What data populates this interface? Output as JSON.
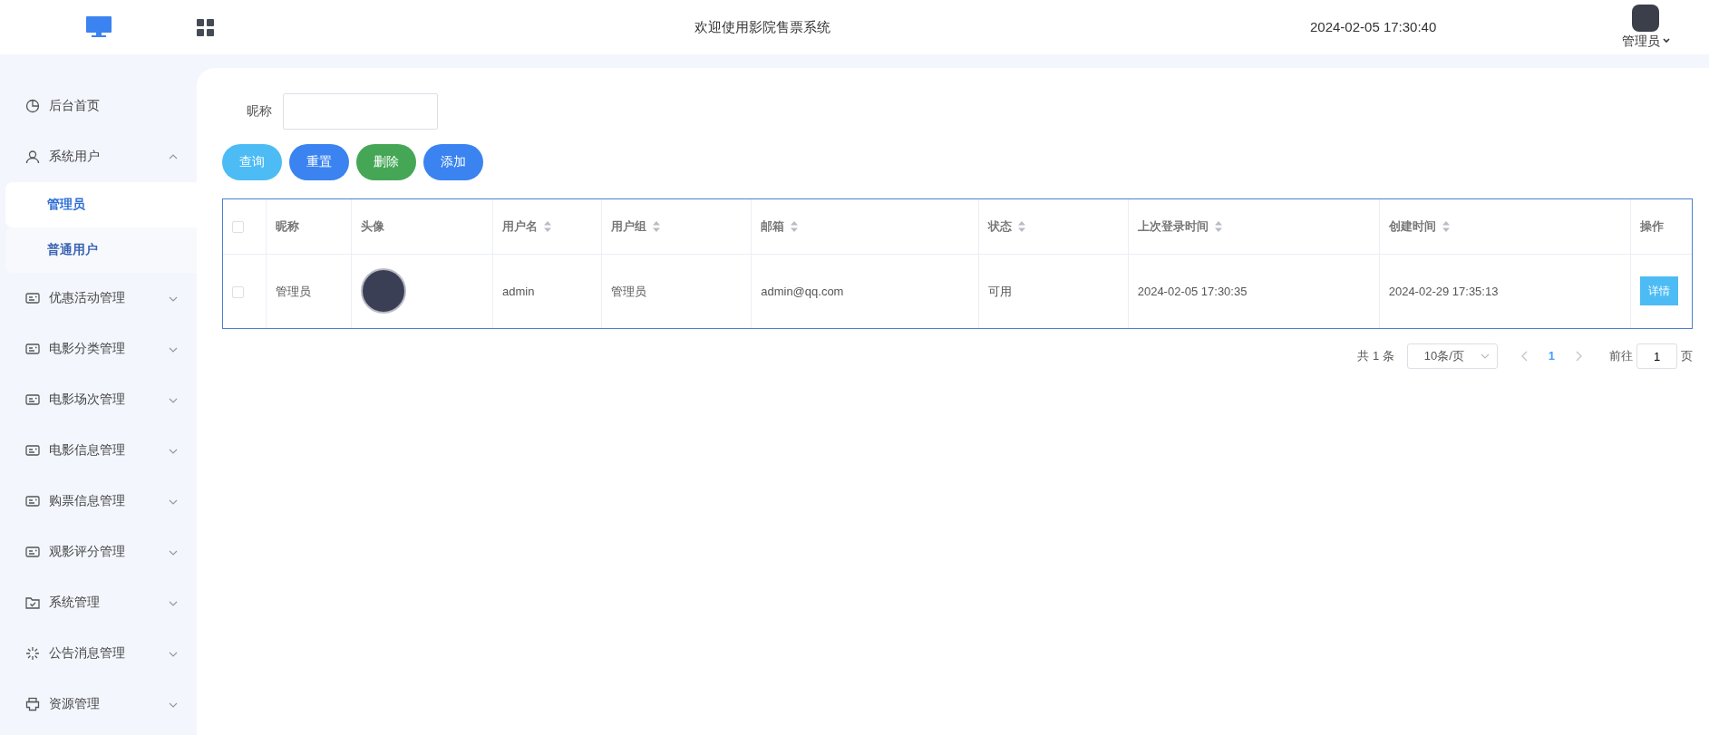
{
  "header": {
    "title": "欢迎使用影院售票系统",
    "datetime": "2024-02-05 17:30:40",
    "user": "管理员"
  },
  "sidebar": {
    "items": [
      {
        "label": "后台首页",
        "kind": "dashboard"
      },
      {
        "label": "系统用户",
        "kind": "user",
        "expanded": true,
        "children": [
          {
            "label": "管理员",
            "selected": true,
            "hovered": false
          },
          {
            "label": "普通用户",
            "selected": false,
            "hovered": true
          }
        ]
      },
      {
        "label": "优惠活动管理",
        "kind": "module",
        "expanded": false
      },
      {
        "label": "电影分类管理",
        "kind": "module",
        "expanded": false
      },
      {
        "label": "电影场次管理",
        "kind": "module",
        "expanded": false
      },
      {
        "label": "电影信息管理",
        "kind": "module",
        "expanded": false
      },
      {
        "label": "购票信息管理",
        "kind": "module",
        "expanded": false
      },
      {
        "label": "观影评分管理",
        "kind": "module",
        "expanded": false
      },
      {
        "label": "系统管理",
        "kind": "folder",
        "expanded": false
      },
      {
        "label": "公告消息管理",
        "kind": "notice",
        "expanded": false
      },
      {
        "label": "资源管理",
        "kind": "resource",
        "expanded": false
      }
    ]
  },
  "search": {
    "label": "昵称"
  },
  "buttons": [
    {
      "label": "查询",
      "color": "#4dbcf4"
    },
    {
      "label": "重置",
      "color": "#3a83f0"
    },
    {
      "label": "删除",
      "color": "#45a756"
    },
    {
      "label": "添加",
      "color": "#3a83f0"
    }
  ],
  "table": {
    "columns": [
      {
        "kind": "checkbox",
        "checked": false
      },
      {
        "kind": "text",
        "label": "昵称",
        "sortable": false
      },
      {
        "kind": "avatar",
        "label": "头像",
        "sortable": false
      },
      {
        "kind": "text",
        "label": "用户名",
        "sortable": true
      },
      {
        "kind": "text",
        "label": "用户组",
        "sortable": true
      },
      {
        "kind": "text",
        "label": "邮箱",
        "sortable": true
      },
      {
        "kind": "text",
        "label": "状态",
        "sortable": true
      },
      {
        "kind": "text",
        "label": "上次登录时间",
        "sortable": true
      },
      {
        "kind": "text",
        "label": "创建时间",
        "sortable": true
      },
      {
        "kind": "action",
        "label": "操作",
        "sortable": false
      }
    ],
    "rows": [
      {
        "checked": false,
        "cells": [
          "",
          "管理员",
          "",
          "admin",
          "管理员",
          "admin@qq.com",
          "可用",
          "2024-02-05 17:30:35",
          "2024-02-29 17:35:13",
          "详情"
        ]
      }
    ]
  },
  "pagination": {
    "total": "共 1 条",
    "page_size": "10条/页",
    "pages": [
      {
        "label": "1",
        "selected": true
      }
    ],
    "goto_label": "前往",
    "goto_value": "1",
    "page_suffix": "页"
  }
}
